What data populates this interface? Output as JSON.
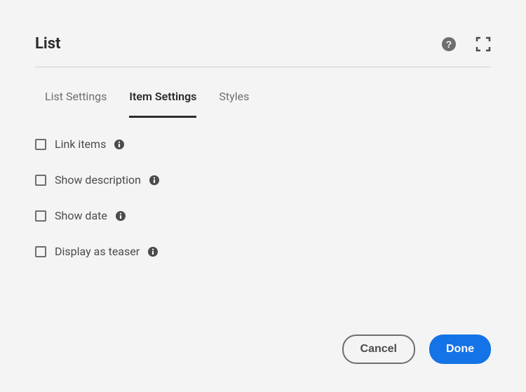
{
  "title": "List",
  "tabs": [
    {
      "label": "List Settings",
      "active": false
    },
    {
      "label": "Item Settings",
      "active": true
    },
    {
      "label": "Styles",
      "active": false
    }
  ],
  "items": [
    {
      "label": "Link items",
      "checked": false
    },
    {
      "label": "Show description",
      "checked": false
    },
    {
      "label": "Show date",
      "checked": false
    },
    {
      "label": "Display as teaser",
      "checked": false
    }
  ],
  "footer": {
    "cancel": "Cancel",
    "done": "Done"
  }
}
